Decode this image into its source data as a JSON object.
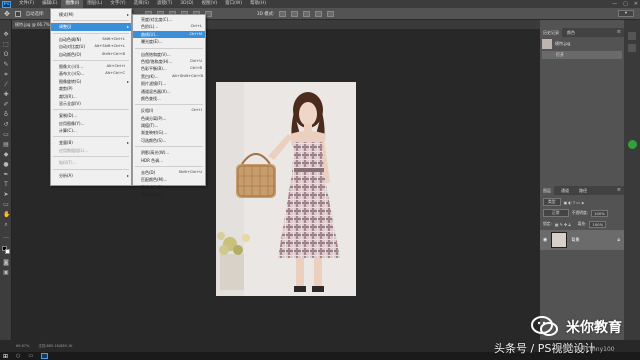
{
  "menubar": {
    "logo": "Ps",
    "items": [
      "文件(F)",
      "编辑(E)",
      "图像(I)",
      "图层(L)",
      "文字(Y)",
      "选择(S)",
      "滤镜(T)",
      "3D(D)",
      "视图(V)",
      "窗口(W)",
      "帮助(H)"
    ],
    "active_index": 2,
    "window_controls": [
      "—",
      "▢",
      "✕"
    ]
  },
  "options_bar": {
    "auto_select_label": "自动选择:",
    "layer_label": "图层",
    "transform_label": "显示变换控件",
    "mode_label": "3D 模式:"
  },
  "document_tab": "模特.jpg @ 66.7%(RGB/8#)",
  "image_menu": {
    "items": [
      {
        "label": "模式(M)",
        "shortcut": "",
        "submenu": true,
        "disabled": false,
        "highlight": false
      },
      {
        "sep": true
      },
      {
        "label": "调整(J)",
        "shortcut": "",
        "submenu": true,
        "disabled": false,
        "highlight": true
      },
      {
        "sep": true
      },
      {
        "label": "自动色调(N)",
        "shortcut": "Shift+Ctrl+L",
        "submenu": false,
        "disabled": false,
        "highlight": false
      },
      {
        "label": "自动对比度(U)",
        "shortcut": "Alt+Shift+Ctrl+L",
        "submenu": false,
        "disabled": false,
        "highlight": false
      },
      {
        "label": "自动颜色(O)",
        "shortcut": "Shift+Ctrl+B",
        "submenu": false,
        "disabled": false,
        "highlight": false
      },
      {
        "sep": true
      },
      {
        "label": "图像大小(I)...",
        "shortcut": "Alt+Ctrl+I",
        "submenu": false,
        "disabled": false,
        "highlight": false
      },
      {
        "label": "画布大小(S)...",
        "shortcut": "Alt+Ctrl+C",
        "submenu": false,
        "disabled": false,
        "highlight": false
      },
      {
        "label": "图像旋转(G)",
        "shortcut": "",
        "submenu": true,
        "disabled": false,
        "highlight": false
      },
      {
        "label": "裁剪(P)",
        "shortcut": "",
        "submenu": false,
        "disabled": false,
        "highlight": false
      },
      {
        "label": "裁切(R)...",
        "shortcut": "",
        "submenu": false,
        "disabled": false,
        "highlight": false
      },
      {
        "label": "显示全部(V)",
        "shortcut": "",
        "submenu": false,
        "disabled": false,
        "highlight": false
      },
      {
        "sep": true
      },
      {
        "label": "复制(D)...",
        "shortcut": "",
        "submenu": false,
        "disabled": false,
        "highlight": false
      },
      {
        "label": "应用图像(Y)...",
        "shortcut": "",
        "submenu": false,
        "disabled": false,
        "highlight": false
      },
      {
        "label": "计算(C)...",
        "shortcut": "",
        "submenu": false,
        "disabled": false,
        "highlight": false
      },
      {
        "sep": true
      },
      {
        "label": "变量(B)",
        "shortcut": "",
        "submenu": true,
        "disabled": false,
        "highlight": false
      },
      {
        "label": "应用数据组(L)...",
        "shortcut": "",
        "submenu": false,
        "disabled": true,
        "highlight": false
      },
      {
        "sep": true
      },
      {
        "label": "陷印(T)...",
        "shortcut": "",
        "submenu": false,
        "disabled": true,
        "highlight": false
      },
      {
        "sep": true
      },
      {
        "label": "分析(A)",
        "shortcut": "",
        "submenu": true,
        "disabled": false,
        "highlight": false
      }
    ]
  },
  "adjust_menu": {
    "items": [
      {
        "label": "亮度/对比度(C)...",
        "shortcut": "",
        "highlight": false
      },
      {
        "label": "色阶(L)...",
        "shortcut": "Ctrl+L",
        "highlight": false
      },
      {
        "label": "曲线(U)...",
        "shortcut": "Ctrl+M",
        "highlight": true
      },
      {
        "label": "曝光度(E)...",
        "shortcut": "",
        "highlight": false
      },
      {
        "sep": true
      },
      {
        "label": "自然饱和度(V)...",
        "shortcut": "",
        "highlight": false
      },
      {
        "label": "色相/饱和度(H)...",
        "shortcut": "Ctrl+U",
        "highlight": false
      },
      {
        "label": "色彩平衡(B)...",
        "shortcut": "Ctrl+B",
        "highlight": false
      },
      {
        "label": "黑白(K)...",
        "shortcut": "Alt+Shift+Ctrl+B",
        "highlight": false
      },
      {
        "label": "照片滤镜(F)...",
        "shortcut": "",
        "highlight": false
      },
      {
        "label": "通道混合器(X)...",
        "shortcut": "",
        "highlight": false
      },
      {
        "label": "颜色查找...",
        "shortcut": "",
        "highlight": false
      },
      {
        "sep": true
      },
      {
        "label": "反相(I)",
        "shortcut": "Ctrl+I",
        "highlight": false
      },
      {
        "label": "色调分离(P)...",
        "shortcut": "",
        "highlight": false
      },
      {
        "label": "阈值(T)...",
        "shortcut": "",
        "highlight": false
      },
      {
        "label": "渐变映射(G)...",
        "shortcut": "",
        "highlight": false
      },
      {
        "label": "可选颜色(S)...",
        "shortcut": "",
        "highlight": false
      },
      {
        "sep": true
      },
      {
        "label": "阴影/高光(W)...",
        "shortcut": "",
        "highlight": false
      },
      {
        "label": "HDR 色调...",
        "shortcut": "",
        "highlight": false
      },
      {
        "sep": true
      },
      {
        "label": "去色(D)",
        "shortcut": "Shift+Ctrl+U",
        "highlight": false
      },
      {
        "label": "匹配颜色(M)...",
        "shortcut": "",
        "highlight": false
      },
      {
        "label": "替换颜色(R)...",
        "shortcut": "",
        "highlight": false
      },
      {
        "label": "色调均化(Q)",
        "shortcut": "",
        "highlight": false
      }
    ]
  },
  "history_panel": {
    "tabs": [
      "历史记录",
      "颜色"
    ],
    "snapshot_label": "模特.jpg",
    "step_label": "打开"
  },
  "layers_panel": {
    "tabs": [
      "图层",
      "通道",
      "路径"
    ],
    "kind_label": "类型",
    "blend_mode": "正常",
    "opacity_label": "不透明度:",
    "opacity_value": "100%",
    "lock_label": "锁定:",
    "fill_label": "填充:",
    "fill_value": "100%",
    "layer_name": "背景"
  },
  "status_bar": {
    "zoom": "66.67%",
    "doc_info": "文档:889.1K/889.1K"
  },
  "watermark": {
    "brand": "米你教育",
    "line1": "头条号 / PS视觉设计",
    "line2": "微信公众号: mny100"
  },
  "colors": {
    "accent": "#3b8fd9",
    "panel": "#535353",
    "workspace": "#282828"
  }
}
